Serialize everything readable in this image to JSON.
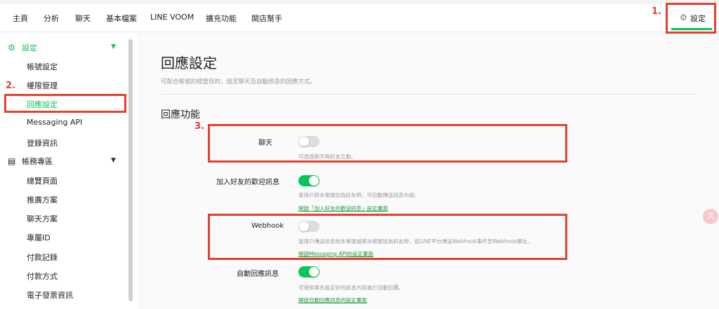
{
  "topnav": {
    "items": [
      "主頁",
      "分析",
      "聊天",
      "基本檔案",
      "LINE VOOM",
      "擴充功能",
      "開店幫手"
    ],
    "settings_label": "設定"
  },
  "sidebar": {
    "settings_section": "設定",
    "settings_items": [
      "帳號設定",
      "權限管理",
      "回應設定",
      "Messaging API",
      "登錄資訊"
    ],
    "billing_section": "帳務專區",
    "billing_items": [
      "總覽頁面",
      "推廣方案",
      "聊天方案",
      "專屬ID",
      "付款記錄",
      "付款方式",
      "電子發票資訊"
    ],
    "active_item": "回應設定"
  },
  "main": {
    "title": "回應設定",
    "subtitle": "可配合帳號的經營目的，設定聊天及自動訊息的回應方式。",
    "section_title": "回應功能",
    "rows": [
      {
        "label": "聊天",
        "enabled": false,
        "desc": "可透過聊天與好友互動。",
        "link": ""
      },
      {
        "label": "加入好友的歡迎訊息",
        "enabled": true,
        "desc": "當用戶將本帳號加為好友時，可自動傳送訊息內容。",
        "link": "開啟「加入好友的歡迎訊息」設定畫面"
      },
      {
        "label": "Webhook",
        "enabled": false,
        "desc": "當用戶傳送訊息給本帳號或將本帳號加為好友時，從LINE平台傳送Webhook事件至Webhook網址。",
        "link": "開啟Messaging API的設定畫面"
      },
      {
        "label": "自動回應訊息",
        "enabled": true,
        "desc": "可使用事先設定好的訊息內容進行自動回覆。",
        "link": "開啟自動回應訊息的設定畫面"
      }
    ]
  },
  "annotations": [
    "1.",
    "2.",
    "3."
  ],
  "colors": {
    "accent": "#06c755",
    "annotation": "#e3412f",
    "link": "#1f9c3b"
  },
  "icons": {
    "settings": "gear-icon",
    "billing": "document-icon",
    "caret": "caret-down-icon"
  }
}
